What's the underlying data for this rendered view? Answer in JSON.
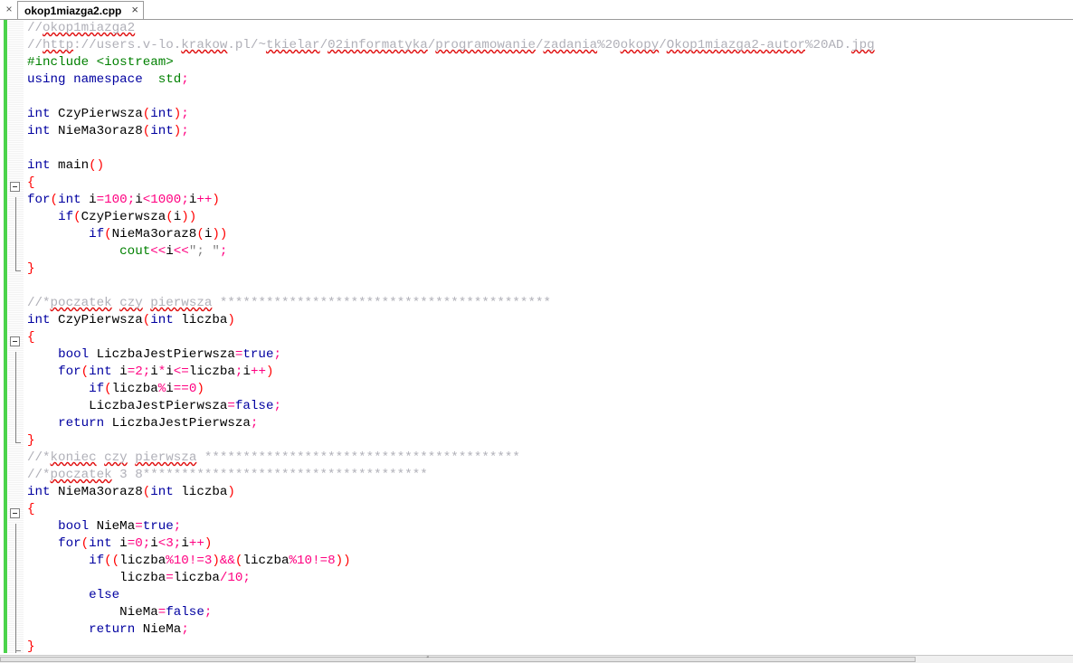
{
  "tab": {
    "title": "okop1miazga2.cpp",
    "close_glyph": "×",
    "close_all_glyph": "×"
  },
  "code": {
    "lines": [
      [
        [
          "cm",
          "//"
        ],
        [
          "cm sq",
          "okop1miazga2"
        ]
      ],
      [
        [
          "cm",
          "//"
        ],
        [
          "cm sq",
          "http"
        ],
        [
          "cm",
          "://users.v-lo."
        ],
        [
          "cm sq",
          "krakow"
        ],
        [
          "cm",
          ".pl/~"
        ],
        [
          "cm sq",
          "tkielar"
        ],
        [
          "cm",
          "/"
        ],
        [
          "cm sq",
          "02informatyka"
        ],
        [
          "cm",
          "/"
        ],
        [
          "cm sq",
          "programowanie"
        ],
        [
          "cm",
          "/"
        ],
        [
          "cm sq",
          "zadania"
        ],
        [
          "cm",
          "%20"
        ],
        [
          "cm sq",
          "okopy"
        ],
        [
          "cm",
          "/"
        ],
        [
          "cm sq",
          "Okop1miazga2-autor"
        ],
        [
          "cm",
          "%20AD."
        ],
        [
          "cm sq",
          "jpg"
        ]
      ],
      [
        [
          "pp",
          "#include <iostream>"
        ]
      ],
      [
        [
          "kw",
          "using namespace"
        ],
        [
          "",
          "  "
        ],
        [
          "std",
          "std"
        ],
        [
          "op",
          ";"
        ]
      ],
      [],
      [
        [
          "kw",
          "int"
        ],
        [
          "",
          " CzyPierwsza"
        ],
        [
          "pr",
          "("
        ],
        [
          "kw",
          "int"
        ],
        [
          "pr",
          ")"
        ],
        [
          "op",
          ";"
        ]
      ],
      [
        [
          "kw",
          "int"
        ],
        [
          "",
          " NieMa3oraz8"
        ],
        [
          "pr",
          "("
        ],
        [
          "kw",
          "int"
        ],
        [
          "pr",
          ")"
        ],
        [
          "op",
          ";"
        ]
      ],
      [],
      [
        [
          "kw",
          "int"
        ],
        [
          "",
          " main"
        ],
        [
          "pr",
          "()"
        ]
      ],
      [
        [
          "pr",
          "{"
        ]
      ],
      [
        [
          "kw",
          "for"
        ],
        [
          "pr",
          "("
        ],
        [
          "kw",
          "int"
        ],
        [
          "",
          " i"
        ],
        [
          "op",
          "="
        ],
        [
          "num",
          "100"
        ],
        [
          "op",
          ";"
        ],
        [
          "",
          "i"
        ],
        [
          "op",
          "<"
        ],
        [
          "num",
          "1000"
        ],
        [
          "op",
          ";"
        ],
        [
          "",
          "i"
        ],
        [
          "op",
          "++"
        ],
        [
          "pr",
          ")"
        ]
      ],
      [
        [
          "",
          "    "
        ],
        [
          "kw",
          "if"
        ],
        [
          "pr",
          "("
        ],
        [
          "",
          "CzyPierwsza"
        ],
        [
          "pr",
          "("
        ],
        [
          "",
          "i"
        ],
        [
          "pr",
          "))"
        ]
      ],
      [
        [
          "",
          "        "
        ],
        [
          "kw",
          "if"
        ],
        [
          "pr",
          "("
        ],
        [
          "",
          "NieMa3oraz8"
        ],
        [
          "pr",
          "("
        ],
        [
          "",
          "i"
        ],
        [
          "pr",
          "))"
        ]
      ],
      [
        [
          "",
          "            "
        ],
        [
          "std",
          "cout"
        ],
        [
          "op",
          "<<"
        ],
        [
          "",
          "i"
        ],
        [
          "op",
          "<<"
        ],
        [
          "str",
          "\"; \""
        ],
        [
          "op",
          ";"
        ]
      ],
      [
        [
          "pr",
          "}"
        ]
      ],
      [],
      [
        [
          "cm",
          "//*"
        ],
        [
          "cm sq",
          "poczatek"
        ],
        [
          "cm",
          " "
        ],
        [
          "cm sq",
          "czy"
        ],
        [
          "cm",
          " "
        ],
        [
          "cm sq",
          "pierwsza"
        ],
        [
          "cm",
          " *******************************************"
        ]
      ],
      [
        [
          "kw",
          "int"
        ],
        [
          "",
          " CzyPierwsza"
        ],
        [
          "pr",
          "("
        ],
        [
          "kw",
          "int"
        ],
        [
          "",
          " liczba"
        ],
        [
          "pr",
          ")"
        ]
      ],
      [
        [
          "pr",
          "{"
        ]
      ],
      [
        [
          "",
          "    "
        ],
        [
          "kw",
          "bool"
        ],
        [
          "",
          " LiczbaJestPierwsza"
        ],
        [
          "op",
          "="
        ],
        [
          "kw",
          "true"
        ],
        [
          "op",
          ";"
        ]
      ],
      [
        [
          "",
          "    "
        ],
        [
          "kw",
          "for"
        ],
        [
          "pr",
          "("
        ],
        [
          "kw",
          "int"
        ],
        [
          "",
          " i"
        ],
        [
          "op",
          "="
        ],
        [
          "num",
          "2"
        ],
        [
          "op",
          ";"
        ],
        [
          "",
          "i"
        ],
        [
          "op",
          "*"
        ],
        [
          "",
          "i"
        ],
        [
          "op",
          "<="
        ],
        [
          "",
          "liczba"
        ],
        [
          "op",
          ";"
        ],
        [
          "",
          "i"
        ],
        [
          "op",
          "++"
        ],
        [
          "pr",
          ")"
        ]
      ],
      [
        [
          "",
          "        "
        ],
        [
          "kw",
          "if"
        ],
        [
          "pr",
          "("
        ],
        [
          "",
          "liczba"
        ],
        [
          "op",
          "%"
        ],
        [
          "",
          "i"
        ],
        [
          "op",
          "=="
        ],
        [
          "num",
          "0"
        ],
        [
          "pr",
          ")"
        ]
      ],
      [
        [
          "",
          "        "
        ],
        [
          "",
          "LiczbaJestPierwsza"
        ],
        [
          "op",
          "="
        ],
        [
          "kw",
          "false"
        ],
        [
          "op",
          ";"
        ]
      ],
      [
        [
          "",
          "    "
        ],
        [
          "kw",
          "return"
        ],
        [
          "",
          " LiczbaJestPierwsza"
        ],
        [
          "op",
          ";"
        ]
      ],
      [
        [
          "pr",
          "}"
        ]
      ],
      [
        [
          "cm",
          "//*"
        ],
        [
          "cm sq",
          "koniec"
        ],
        [
          "cm",
          " "
        ],
        [
          "cm sq",
          "czy"
        ],
        [
          "cm",
          " "
        ],
        [
          "cm sq",
          "pierwsza"
        ],
        [
          "cm",
          " *****************************************"
        ]
      ],
      [
        [
          "cm",
          "//*"
        ],
        [
          "cm sq",
          "poczatek"
        ],
        [
          "cm",
          " 3 8*************************************"
        ]
      ],
      [
        [
          "kw",
          "int"
        ],
        [
          "",
          " NieMa3oraz8"
        ],
        [
          "pr",
          "("
        ],
        [
          "kw",
          "int"
        ],
        [
          "",
          " liczba"
        ],
        [
          "pr",
          ")"
        ]
      ],
      [
        [
          "pr",
          "{"
        ]
      ],
      [
        [
          "",
          "    "
        ],
        [
          "kw",
          "bool"
        ],
        [
          "",
          " NieMa"
        ],
        [
          "op",
          "="
        ],
        [
          "kw",
          "true"
        ],
        [
          "op",
          ";"
        ]
      ],
      [
        [
          "",
          "    "
        ],
        [
          "kw",
          "for"
        ],
        [
          "pr",
          "("
        ],
        [
          "kw",
          "int"
        ],
        [
          "",
          " i"
        ],
        [
          "op",
          "="
        ],
        [
          "num",
          "0"
        ],
        [
          "op",
          ";"
        ],
        [
          "",
          "i"
        ],
        [
          "op",
          "<"
        ],
        [
          "num",
          "3"
        ],
        [
          "op",
          ";"
        ],
        [
          "",
          "i"
        ],
        [
          "op",
          "++"
        ],
        [
          "pr",
          ")"
        ]
      ],
      [
        [
          "",
          "        "
        ],
        [
          "kw",
          "if"
        ],
        [
          "pr",
          "(("
        ],
        [
          "",
          "liczba"
        ],
        [
          "op",
          "%"
        ],
        [
          "num",
          "10"
        ],
        [
          "op",
          "!="
        ],
        [
          "num",
          "3"
        ],
        [
          "pr",
          ")"
        ],
        [
          "op",
          "&&"
        ],
        [
          "pr",
          "("
        ],
        [
          "",
          "liczba"
        ],
        [
          "op",
          "%"
        ],
        [
          "num",
          "10"
        ],
        [
          "op",
          "!="
        ],
        [
          "num",
          "8"
        ],
        [
          "pr",
          "))"
        ]
      ],
      [
        [
          "",
          "            "
        ],
        [
          "",
          "liczba"
        ],
        [
          "op",
          "="
        ],
        [
          "",
          "liczba"
        ],
        [
          "op",
          "/"
        ],
        [
          "num",
          "10"
        ],
        [
          "op",
          ";"
        ]
      ],
      [
        [
          "",
          "        "
        ],
        [
          "kw",
          "else"
        ]
      ],
      [
        [
          "",
          "            "
        ],
        [
          "",
          "NieMa"
        ],
        [
          "op",
          "="
        ],
        [
          "kw",
          "false"
        ],
        [
          "op",
          ";"
        ]
      ],
      [
        [
          "",
          "        "
        ],
        [
          "kw",
          "return"
        ],
        [
          "",
          " NieMa"
        ],
        [
          "op",
          ";"
        ]
      ],
      [
        [
          "pr",
          "}"
        ]
      ]
    ]
  },
  "icons": {
    "fold": "minus-box-icon",
    "grip": "scroll-grip-icon"
  },
  "scrollbar": {
    "grip": "‴"
  }
}
